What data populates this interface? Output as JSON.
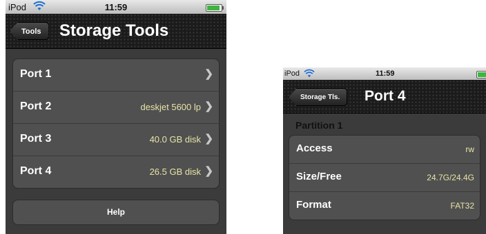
{
  "left": {
    "status": {
      "carrier": "iPod",
      "time": "11:59"
    },
    "nav": {
      "back_label": "Tools",
      "title": "Storage Tools"
    },
    "ports": [
      {
        "label": "Port 1",
        "value": ""
      },
      {
        "label": "Port 2",
        "value": "deskjet 5600 lp"
      },
      {
        "label": "Port 3",
        "value": "40.0 GB disk"
      },
      {
        "label": "Port 4",
        "value": "26.5 GB disk"
      }
    ],
    "help_label": "Help"
  },
  "right": {
    "status": {
      "carrier": "iPod",
      "time": "11:59"
    },
    "nav": {
      "back_label": "Storage Tls.",
      "title": "Port 4"
    },
    "section_header": "Partition 1",
    "details": [
      {
        "label": "Access",
        "value": "rw"
      },
      {
        "label": "Size/Free",
        "value": "24.7G/24.4G"
      },
      {
        "label": "Format",
        "value": "FAT32"
      }
    ]
  },
  "icons": {
    "wifi": "wifi-icon",
    "battery": "battery-icon",
    "chevron": "chevron-right-icon"
  },
  "colors": {
    "accent_value": "#e8e4a8",
    "nav_bg": "#1b1b1b",
    "cell_bg": "#505050"
  }
}
